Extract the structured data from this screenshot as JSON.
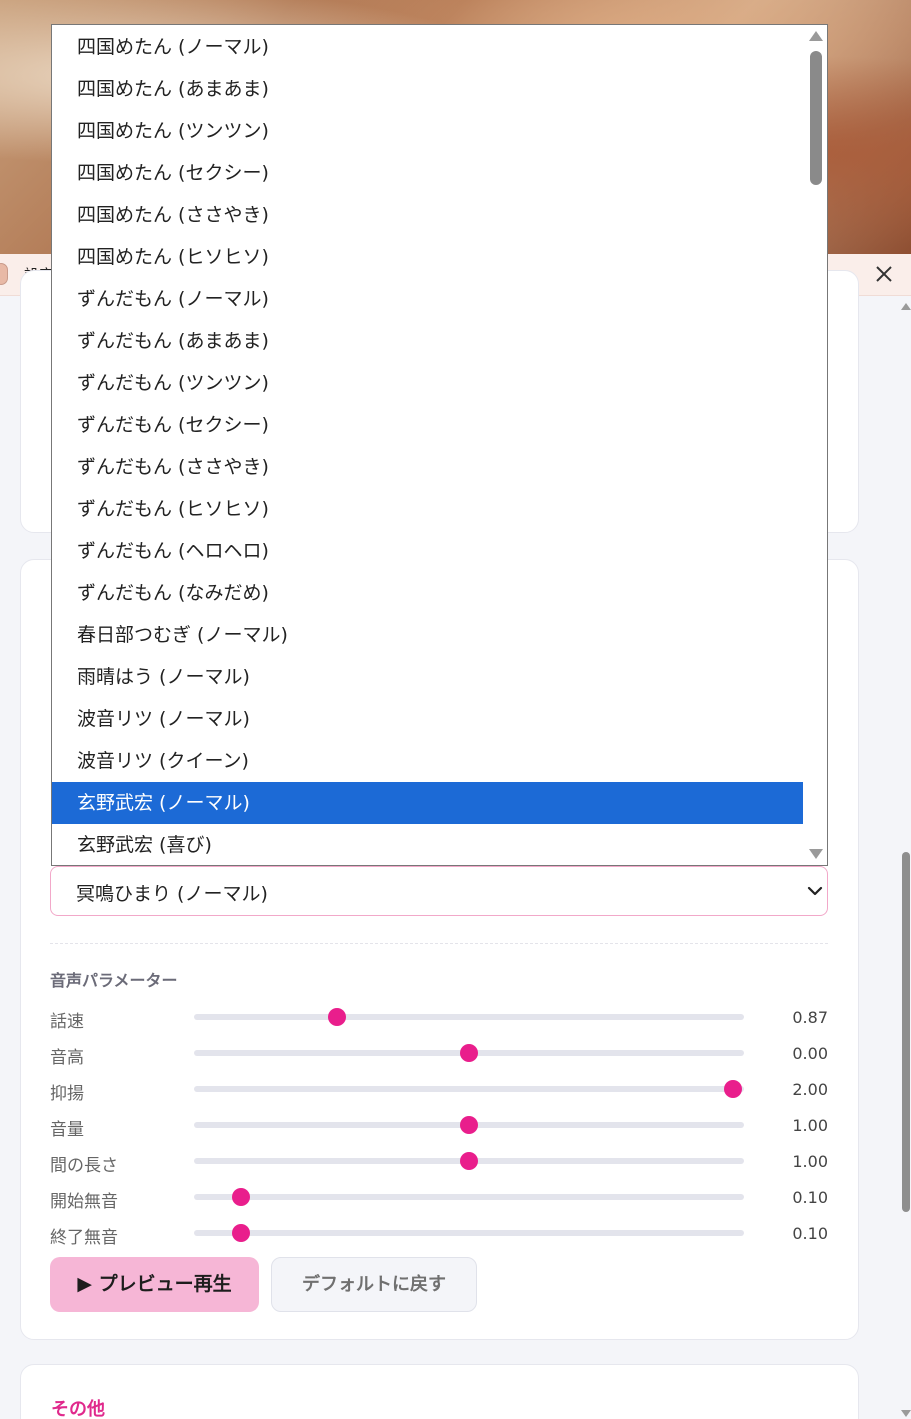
{
  "settings_bar": {
    "title": "設定"
  },
  "voice_select": {
    "selected_label": "冥鳴ひまり (ノーマル)"
  },
  "dropdown": {
    "options": [
      "四国めたん (ノーマル)",
      "四国めたん (あまあま)",
      "四国めたん (ツンツン)",
      "四国めたん (セクシー)",
      "四国めたん (ささやき)",
      "四国めたん (ヒソヒソ)",
      "ずんだもん (ノーマル)",
      "ずんだもん (あまあま)",
      "ずんだもん (ツンツン)",
      "ずんだもん (セクシー)",
      "ずんだもん (ささやき)",
      "ずんだもん (ヒソヒソ)",
      "ずんだもん (ヘロヘロ)",
      "ずんだもん (なみだめ)",
      "春日部つむぎ (ノーマル)",
      "雨晴はう (ノーマル)",
      "波音リツ (ノーマル)",
      "波音リツ (クイーン)",
      "玄野武宏 (ノーマル)",
      "玄野武宏 (喜び)"
    ],
    "highlighted_index": 18
  },
  "voice_params": {
    "title": "音声パラメーター",
    "items": [
      {
        "label": "話速",
        "value": "0.87",
        "fraction": 0.26
      },
      {
        "label": "音高",
        "value": "0.00",
        "fraction": 0.5
      },
      {
        "label": "抑揚",
        "value": "2.00",
        "fraction": 0.98
      },
      {
        "label": "音量",
        "value": "1.00",
        "fraction": 0.5
      },
      {
        "label": "間の長さ",
        "value": "1.00",
        "fraction": 0.5
      },
      {
        "label": "開始無音",
        "value": "0.10",
        "fraction": 0.085
      },
      {
        "label": "終了無音",
        "value": "0.10",
        "fraction": 0.085
      }
    ]
  },
  "buttons": {
    "preview_label": "▶ プレビュー再生",
    "reset_label": "デフォルトに戻す"
  },
  "other_section": {
    "title": "その他"
  },
  "colors": {
    "accent": "#e91e8c",
    "selection": "#1c6ad6",
    "preview_button_bg": "#f6b6d6"
  }
}
